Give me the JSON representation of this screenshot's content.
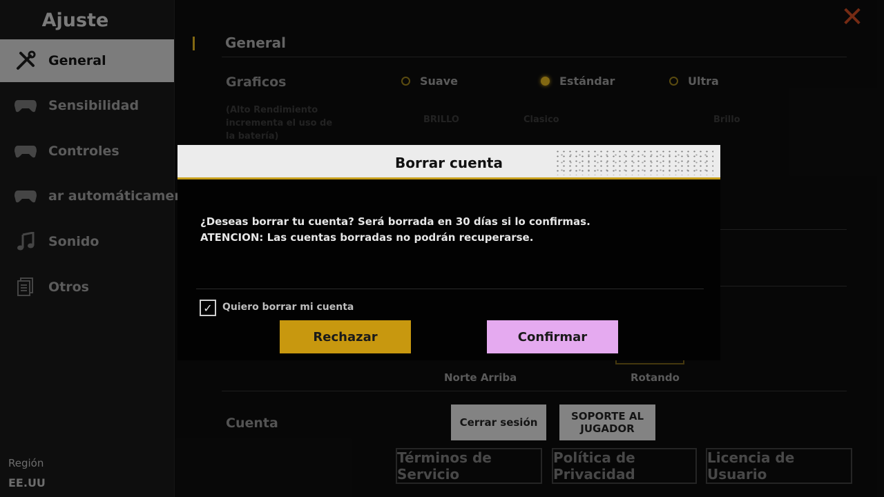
{
  "sidebar": {
    "title": "Ajuste",
    "items": [
      {
        "label": "General",
        "icon": "tools-icon"
      },
      {
        "label": "Sensibilidad",
        "icon": "gamepad-icon"
      },
      {
        "label": "Controles",
        "icon": "gamepad-icon"
      },
      {
        "label": "ar automáticamente",
        "icon": "gamepad-icon"
      },
      {
        "label": "Sonido",
        "icon": "music-note-icon"
      },
      {
        "label": "Otros",
        "icon": "document-icon"
      }
    ],
    "region_label": "Región",
    "region_value": "EE.UU"
  },
  "main": {
    "section_title": "General",
    "graphics": {
      "label": "Graficos",
      "options": [
        "Suave",
        "Estándar",
        "Ultra"
      ],
      "selected": "Estándar"
    },
    "faded_note": "(Alto Rendimiento incrementa el uso de la batería)",
    "faded_options": [
      "BRILLO",
      "Clasico",
      "Brillo"
    ],
    "map_options": [
      "Norte Arriba",
      "Rotando"
    ],
    "account": {
      "label": "Cuenta",
      "logout": "Cerrar sesión",
      "support": "SOPORTE AL JUGADOR"
    },
    "links": [
      "Términos de Servicio",
      "Política de Privacidad",
      "Licencia de Usuario"
    ]
  },
  "dialog": {
    "title": "Borrar cuenta",
    "message_line1": "¿Deseas borrar tu cuenta? Será borrada en 30 días si lo confirmas.",
    "message_line2": "ATENCION: Las cuentas borradas no podrán recuperarse.",
    "checkbox_label": "Quiero borrar mi cuenta",
    "checkbox_checked": true,
    "reject_label": "Rechazar",
    "confirm_label": "Confirmar"
  },
  "colors": {
    "accent": "#c8a01c",
    "confirm": "#e5aaf0",
    "close": "#b5431f"
  }
}
